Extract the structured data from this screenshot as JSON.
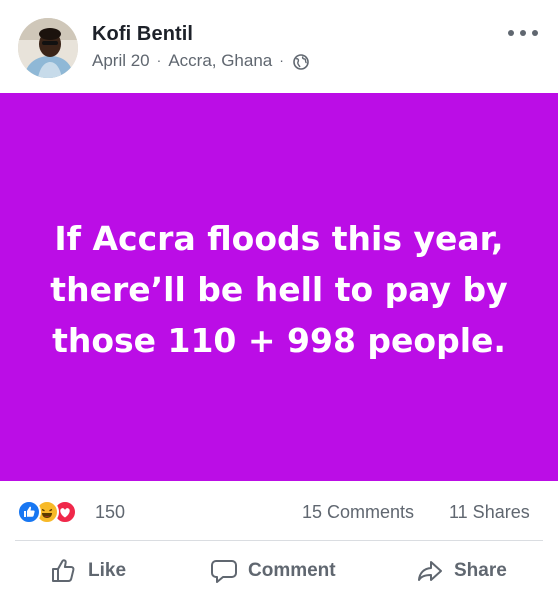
{
  "post": {
    "author": "Kofi Bentil",
    "date": "April 20",
    "separator": "·",
    "location": "Accra, Ghana",
    "privacy_icon": "globe-icon",
    "more_icon": "more-options-icon",
    "status_text": "If Accra floods this year, there’ll be hell to pay by those 110 + 998 people.",
    "status_background": "#bb0de6"
  },
  "engagement": {
    "reaction_icons": [
      "like-reaction-icon",
      "haha-reaction-icon",
      "love-reaction-icon"
    ],
    "reactions_count": "150",
    "comments": "15 Comments",
    "shares": "11 Shares"
  },
  "actions": {
    "like_label": "Like",
    "comment_label": "Comment",
    "share_label": "Share"
  },
  "colors": {
    "secondary_text": "#606770",
    "like_blue": "#1877f2",
    "love_red": "#f0284a",
    "haha_yellow": "#f7b928"
  }
}
